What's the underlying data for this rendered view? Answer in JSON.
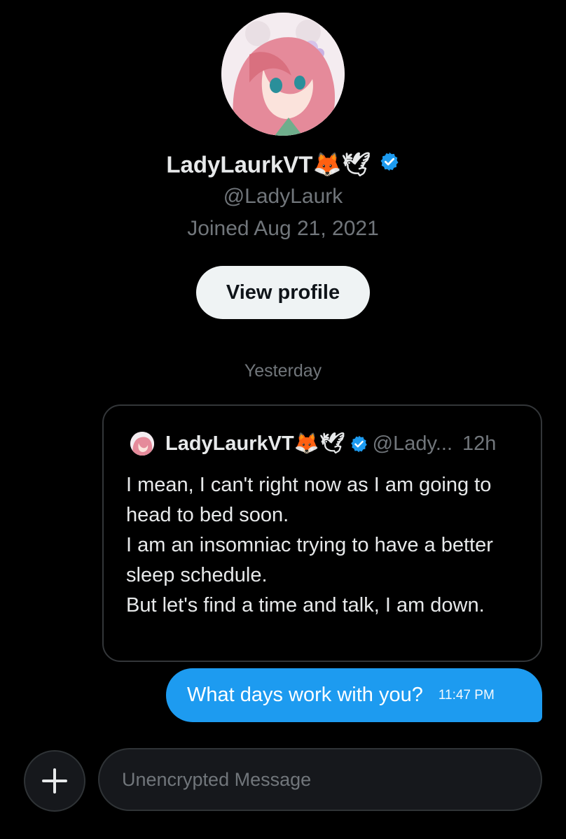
{
  "profile": {
    "display_name": "LadyLaurkVT",
    "name_emojis": "🦊🕊",
    "handle": "@LadyLaurk",
    "joined": "Joined Aug 21, 2021",
    "view_profile_label": "View profile",
    "verified_color": "#1d9bf0"
  },
  "conversation": {
    "day_divider": "Yesterday",
    "quoted_post": {
      "author_name": "LadyLaurkVT",
      "author_emojis": "🦊🕊",
      "author_handle": "@Lady...",
      "time": "12h",
      "lines": [
        "I mean, I can't right now as I am going to head to bed soon.",
        "I am an insomniac trying to have a better sleep schedule.",
        "But let's find a time and talk, I am down."
      ]
    },
    "sent_message": {
      "text": "What days work with you?",
      "time": "11:47 PM",
      "bubble_color": "#1d9bf0"
    }
  },
  "composer": {
    "placeholder": "Unencrypted Message",
    "add_icon": "plus-icon"
  }
}
